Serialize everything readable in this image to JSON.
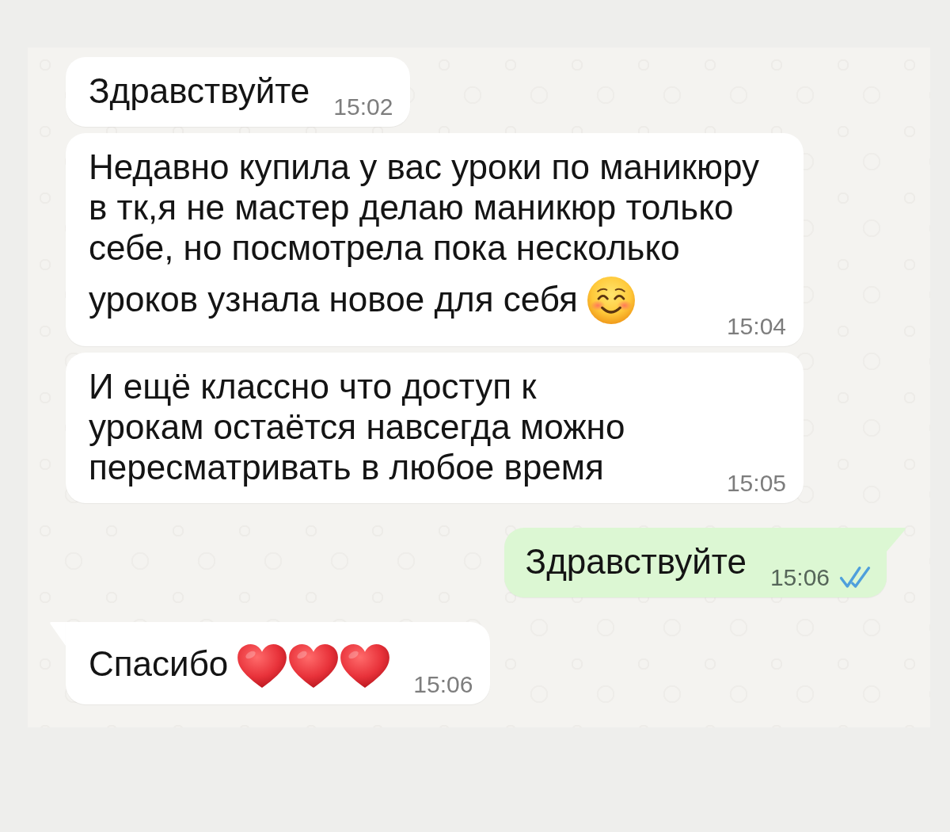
{
  "messages": [
    {
      "outgoing": false,
      "tail": false,
      "lines": [
        "Здравствуйте"
      ],
      "time": "15:02"
    },
    {
      "outgoing": false,
      "tail": false,
      "lines": [
        "Недавно купила у вас уроки по маникюру",
        "в тк,я не мастер делаю маникюр только",
        "себе, но посмотрела пока несколько",
        "уроков узнала новое для себя"
      ],
      "emojis": [
        {
          "kind": "smiling-face"
        }
      ],
      "time": "15:04"
    },
    {
      "outgoing": false,
      "tail": false,
      "lines": [
        "И ещё классно что доступ к",
        "урокам остаётся навсегда можно",
        "пересматривать в любое время"
      ],
      "time": "15:05"
    },
    {
      "outgoing": true,
      "tail": true,
      "lines": [
        "Здравствуйте"
      ],
      "time": "15:06",
      "read": true
    },
    {
      "outgoing": false,
      "tail": true,
      "lines": [
        "Спасибо"
      ],
      "emojis": [
        {
          "kind": "heart"
        },
        {
          "kind": "heart"
        },
        {
          "kind": "heart"
        }
      ],
      "time": "15:06"
    }
  ]
}
